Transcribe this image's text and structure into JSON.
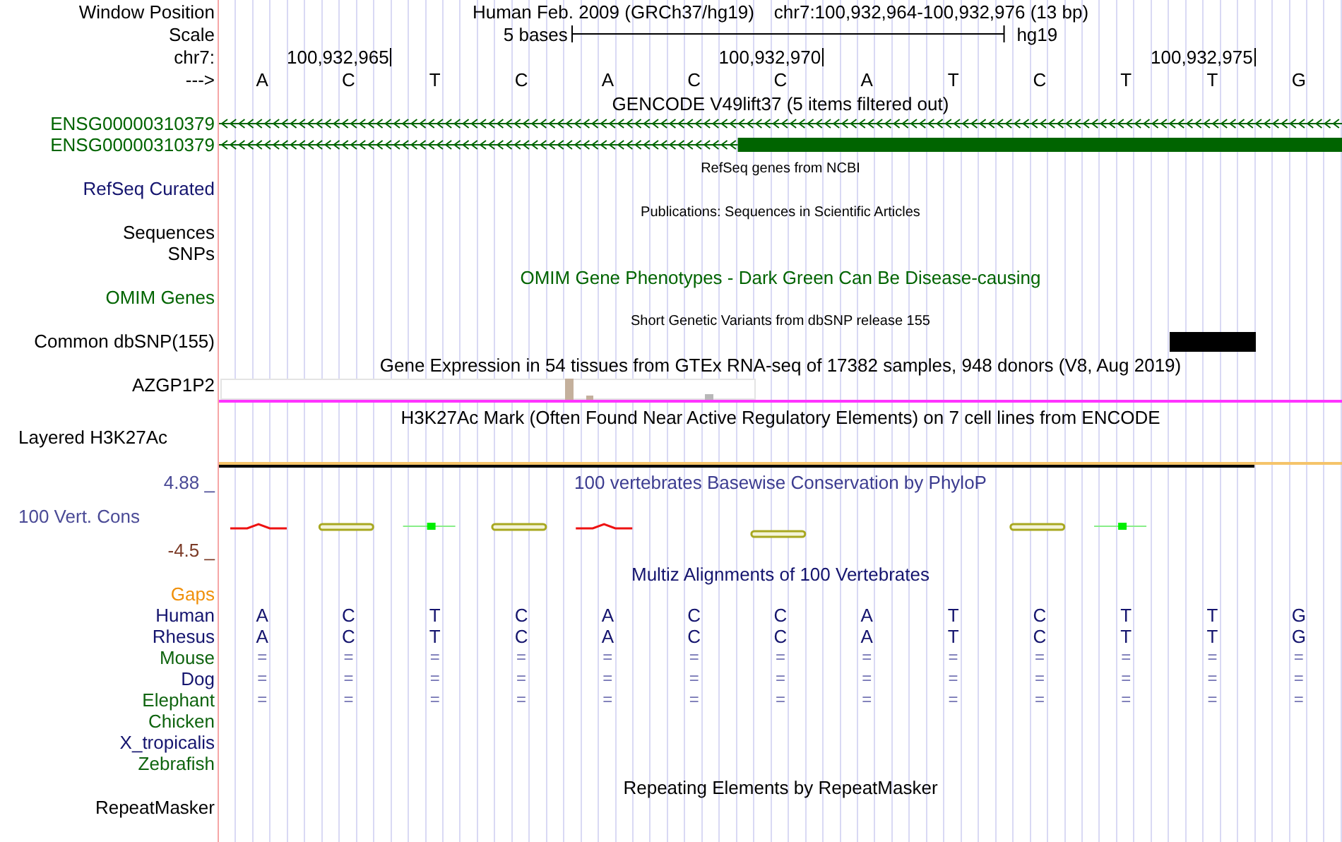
{
  "header": {
    "position_label": "Window Position",
    "assembly": "Human Feb. 2009 (GRCh37/hg19)",
    "range": "chr7:100,932,964-100,932,976 (13 bp)",
    "scale_label": "Scale",
    "scale_text": "5 bases",
    "scale_assembly": "hg19",
    "chrom_label": "chr7:",
    "strand_label": "--->",
    "bases": [
      {
        "letter": "A"
      },
      {
        "letter": "C",
        "coordinate": "100,932,965"
      },
      {
        "letter": "T"
      },
      {
        "letter": "C"
      },
      {
        "letter": "A"
      },
      {
        "letter": "C"
      },
      {
        "letter": "C",
        "coordinate": "100,932,970"
      },
      {
        "letter": "A"
      },
      {
        "letter": "T"
      },
      {
        "letter": "C"
      },
      {
        "letter": "T"
      },
      {
        "letter": "T",
        "coordinate": "100,932,975"
      },
      {
        "letter": "G"
      }
    ]
  },
  "tracks": [
    {
      "title": "GENCODE V49lift37 (5 items filtered out)",
      "kind": "major",
      "color": "#000000",
      "rows": [
        {
          "label": "ENSG00000310379",
          "color": "#006400",
          "kind": "gene"
        },
        {
          "label": "ENSG00000310379",
          "color": "#006400",
          "kind": "gene",
          "level": 0.538
        }
      ]
    },
    {
      "title": "RefSeq genes from NCBI",
      "kind": "minor",
      "color": "#000000",
      "rows": [
        {
          "label": "RefSeq Curated",
          "color": "#14146e",
          "kind": "empty"
        }
      ]
    },
    {
      "title": "Publications: Sequences in Scientific Articles",
      "kind": "minor",
      "color": "#000000",
      "rows": [
        {
          "label": "Sequences",
          "color": "#000000",
          "kind": "empty"
        },
        {
          "label": "SNPs",
          "color": "#000000",
          "kind": "empty"
        }
      ]
    },
    {
      "title": "OMIM Gene Phenotypes - Dark Green Can Be Disease-causing",
      "kind": "major",
      "color": "#006400",
      "rows": [
        {
          "label": "OMIM Genes",
          "color": "#006400",
          "kind": "empty"
        }
      ]
    },
    {
      "title": "Short Genetic Variants from dbSNP release 155",
      "kind": "minor",
      "color": "#000000",
      "rows": [
        {
          "label": "Common dbSNP(155)",
          "color": "#000000",
          "kind": "variants",
          "cells": [
            {
              "kind": "empty"
            },
            {
              "kind": "empty"
            },
            {
              "kind": "empty"
            },
            {
              "kind": "empty"
            },
            {
              "kind": "empty"
            },
            {
              "kind": "empty"
            },
            {
              "kind": "empty"
            },
            {
              "kind": "empty"
            },
            {
              "kind": "empty"
            },
            {
              "kind": "empty"
            },
            {
              "kind": "empty"
            },
            {
              "kind": "variant"
            },
            {
              "kind": "empty"
            }
          ]
        }
      ]
    },
    {
      "title": "Gene Expression in 54 tissues from GTEx RNA-seq of 17382 samples, 948 donors (V8, Aug 2019)",
      "kind": "major",
      "color": "#000000",
      "rows": [
        {
          "label": "AZGP1P2",
          "color": "#000000",
          "kind": "expression"
        }
      ]
    },
    {
      "title": "H3K27Ac Mark (Often Found Near Active Regulatory Elements) on 7 cell lines from ENCODE",
      "kind": "major",
      "color": "#000000",
      "rows": [
        {
          "label": "Layered H3K27Ac",
          "color": "#000000",
          "kind": "signal"
        }
      ]
    },
    {
      "title": "100 vertebrates Basewise Conservation by PhyloP",
      "kind": "graph",
      "color": "#3c3c90",
      "label": "100 Vert. Cons",
      "axis_top": "4.88 _",
      "axis_bottom": "-4.5 _"
    },
    {
      "title": "Multiz Alignments of 100 Vertebrates",
      "kind": "major",
      "color": "#14146e",
      "rows": [
        {
          "label": "Gaps",
          "color": "#f0900a",
          "kind": "empty"
        },
        {
          "label": "Human",
          "color": "#14146e",
          "kind": "alignment",
          "cells": [
            "A",
            "C",
            "T",
            "C",
            "A",
            "C",
            "C",
            "A",
            "T",
            "C",
            "T",
            "T",
            "G"
          ]
        },
        {
          "label": "Rhesus",
          "color": "#14146e",
          "kind": "alignment",
          "cells": [
            "A",
            "C",
            "T",
            "C",
            "A",
            "C",
            "C",
            "A",
            "T",
            "C",
            "T",
            "T",
            "G"
          ]
        },
        {
          "label": "Mouse",
          "color": "#0f640f",
          "kind": "match",
          "cells": [
            "=",
            "=",
            "=",
            "=",
            "=",
            "=",
            "=",
            "=",
            "=",
            "=",
            "=",
            "=",
            "="
          ]
        },
        {
          "label": "Dog",
          "color": "#14146e",
          "kind": "match",
          "cells": [
            "=",
            "=",
            "=",
            "=",
            "=",
            "=",
            "=",
            "=",
            "=",
            "=",
            "=",
            "=",
            "="
          ]
        },
        {
          "label": "Elephant",
          "color": "#0f640f",
          "kind": "match",
          "cells": [
            "=",
            "=",
            "=",
            "=",
            "=",
            "=",
            "=",
            "=",
            "=",
            "=",
            "=",
            "=",
            "="
          ]
        },
        {
          "label": "Chicken",
          "color": "#0f640f",
          "kind": "empty"
        },
        {
          "label": "X_tropicalis",
          "color": "#14146e",
          "kind": "empty"
        },
        {
          "label": "Zebrafish",
          "color": "#0f640f",
          "kind": "empty"
        }
      ]
    },
    {
      "title": "Repeating Elements by RepeatMasker",
      "kind": "major",
      "color": "#000000",
      "rows": [
        {
          "label": "RepeatMasker",
          "color": "#000000",
          "kind": "empty"
        }
      ]
    }
  ]
}
